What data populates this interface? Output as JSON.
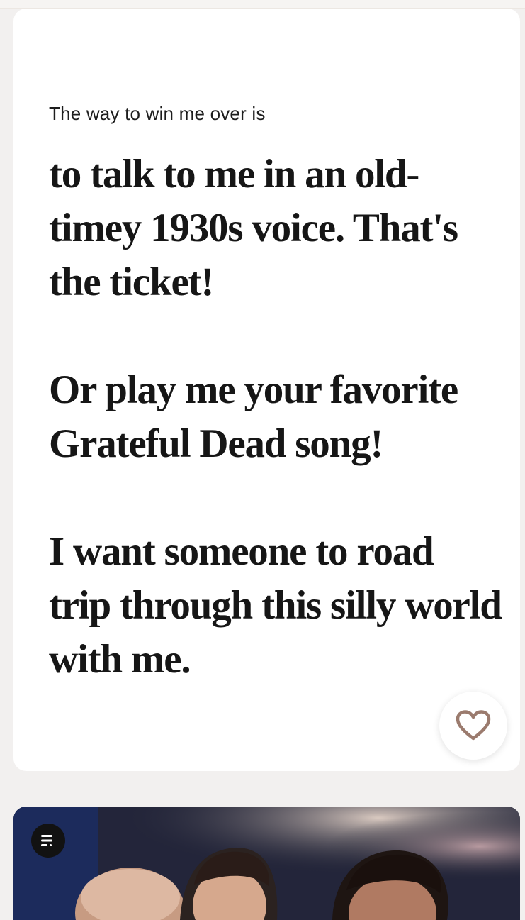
{
  "prompt": {
    "question": "The way to win me over is",
    "answer_paragraphs": [
      "to talk to me in an old-timey 1930s voice. That's the ticket!",
      "Or play me your favorite Grateful Dead song!",
      "I want someone to road trip through this silly world with me."
    ],
    "like_icon": "heart-outline-icon"
  },
  "photo": {
    "badge_icon": "list-caption-icon"
  },
  "colors": {
    "background": "#f2f0ef",
    "card": "#ffffff",
    "heart": "#9b7b6e",
    "text": "#161616"
  }
}
